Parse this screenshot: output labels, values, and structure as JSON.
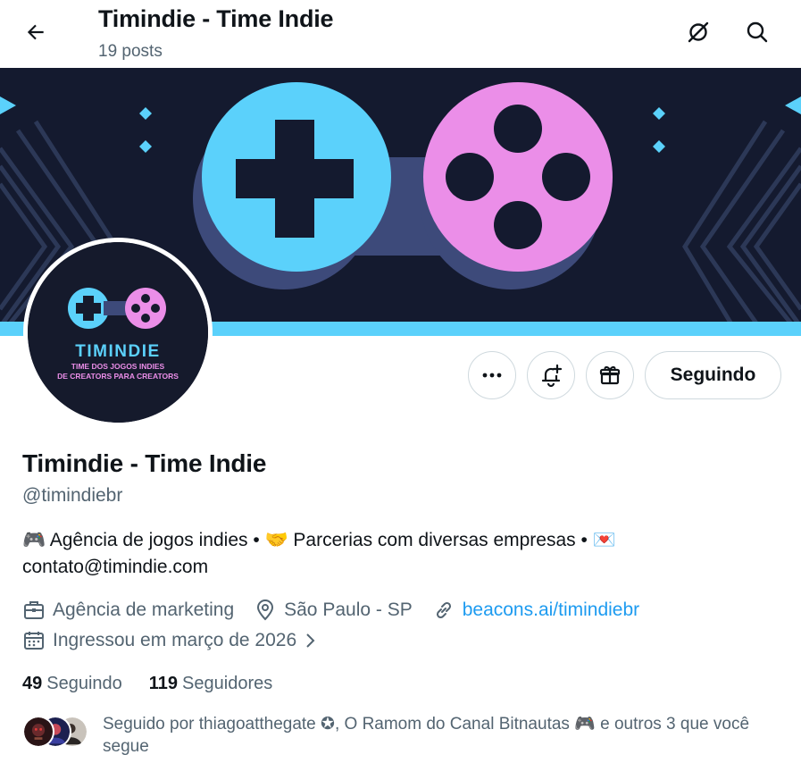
{
  "header": {
    "title": "Timindie - Time Indie",
    "post_count": "19 posts"
  },
  "avatar": {
    "logo_text": "TIMINDIE",
    "tagline_1": "TIME DOS JOGOS INDIES",
    "tagline_2": "DE CREATORS PARA CREATORS"
  },
  "actions": {
    "follow_label": "Seguindo"
  },
  "profile": {
    "name": "Timindie - Time Indie",
    "handle": "@timindiebr",
    "bio_part1": "Agência de jogos indies •",
    "bio_part2": "Parcerias com diversas empresas •",
    "bio_line2": "contato@timindie.com",
    "category": "Agência de marketing",
    "location": "São Paulo - SP",
    "website": "beacons.ai/timindiebr",
    "joined": "Ingressou em março de 2026"
  },
  "stats": {
    "following_count": "49",
    "following_label": "Seguindo",
    "followers_count": "119",
    "followers_label": "Seguidores"
  },
  "followed_by": {
    "text": "Seguido por thiagoatthegate ✪, O Ramom do Canal Bitnautas 🎮 e outros 3 que você segue"
  },
  "colors": {
    "banner_bg": "#141a2f",
    "cyan": "#5bd1fb",
    "pink": "#eb8ee8",
    "link": "#1d9bf0"
  }
}
